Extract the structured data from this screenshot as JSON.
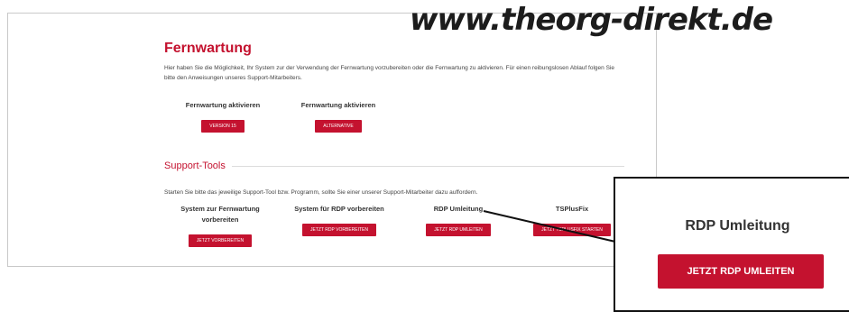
{
  "watermark": "www.theorg-direkt.de",
  "fernwartung": {
    "title": "Fernwartung",
    "description": "Hier haben Sie die Möglichkeit, Ihr System zur der Verwendung der Fernwartung vorzubereiten oder die Fernwartung zu aktivieren. Für einen reibungslosen Ablauf folgen Sie bitte den Anweisungen unseres Support-Mitarbeiters.",
    "groups": [
      {
        "label": "Fernwartung aktivieren",
        "button": "VERSION 15"
      },
      {
        "label": "Fernwartung aktivieren",
        "button": "ALTERNATIVE"
      }
    ]
  },
  "support_tools": {
    "title": "Support-Tools",
    "description": "Starten Sie bitte das jeweilige Support-Tool bzw. Programm, sollte Sie einer unserer Support-Mitarbeiter dazu auffordern.",
    "tools": [
      {
        "label": "System zur Fernwartung vorbereiten",
        "button": "JETZT VORBEREITEN"
      },
      {
        "label": "System für RDP vorbereiten",
        "button": "JETZT RDP VORBEREITEN"
      },
      {
        "label": "RDP Umleitung",
        "button": "JETZT RDP UMLEITEN"
      },
      {
        "label": "TSPlusFix",
        "button": "JETZT TSPLUSFIX STARTEN"
      }
    ]
  },
  "zoom_callout": {
    "label": "RDP Umleitung",
    "button": "JETZT RDP UMLEITEN"
  }
}
